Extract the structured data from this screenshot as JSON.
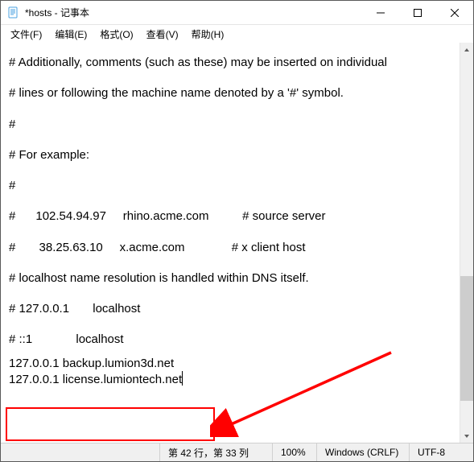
{
  "window": {
    "title": "*hosts - 记事本"
  },
  "menu": {
    "file": "文件(F)",
    "edit": "编辑(E)",
    "format": "格式(O)",
    "view": "查看(V)",
    "help": "帮助(H)"
  },
  "text": {
    "l1": "# Additionally, comments (such as these) may be inserted on individual",
    "l2": "# lines or following the machine name denoted by a '#' symbol.",
    "l3": "#",
    "l4": "# For example:",
    "l5": "#",
    "l6": "#      102.54.94.97     rhino.acme.com          # source server",
    "l7": "#       38.25.63.10     x.acme.com              # x client host",
    "l8": "# localhost name resolution is handled within DNS itself.",
    "l9": "# 127.0.0.1       localhost",
    "l10": "# ::1             localhost",
    "l11": "127.0.0.1 backup.lumion3d.net",
    "l12": "127.0.0.1 license.lumiontech.net"
  },
  "status": {
    "pos": "第 42 行，第 33 列",
    "zoom": "100%",
    "eol": "Windows (CRLF)",
    "enc": "UTF-8"
  }
}
